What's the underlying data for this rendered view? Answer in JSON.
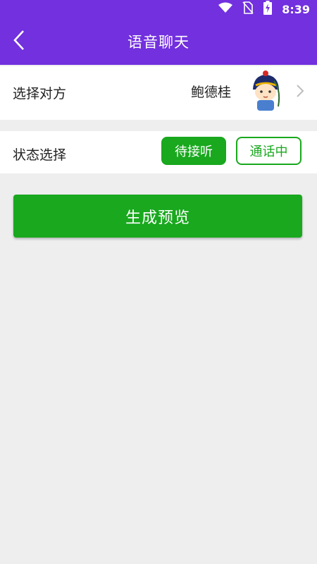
{
  "status_bar": {
    "time": "8:39",
    "icons": [
      "wifi-icon",
      "no-sim-icon",
      "battery-charging-icon"
    ]
  },
  "header": {
    "title": "语音聊天",
    "back_icon": "chevron-left-icon"
  },
  "peer_row": {
    "label": "选择对方",
    "name": "鲍德桂",
    "avatar_icon": "cartoon-official-avatar",
    "chevron_icon": "chevron-right-icon"
  },
  "state_row": {
    "label": "状态选择",
    "options": [
      "待接听",
      "通话中"
    ],
    "selected": "待接听"
  },
  "preview_button": {
    "label": "生成预览"
  },
  "colors": {
    "header_bg": "#7230de",
    "accent_green": "#19a81e",
    "page_bg": "#eeeeee"
  }
}
